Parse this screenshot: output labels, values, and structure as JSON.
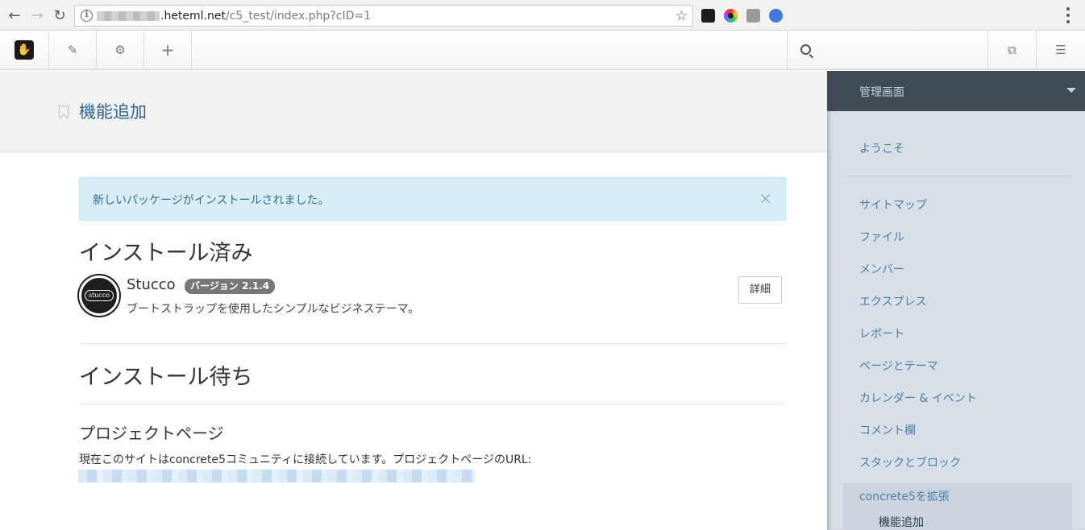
{
  "browser": {
    "url_domain": ".heteml.net",
    "url_path": "/c5_test/index.php?cID=1",
    "back_icon": "←",
    "forward_icon": "→",
    "reload_icon": "↻",
    "star_icon": "☆"
  },
  "toolbar": {
    "logo_icon": "✋",
    "edit_icon": "✎",
    "settings_icon": "⚙",
    "add_icon": "+",
    "pages_icon": "⧉",
    "dashboard_icon": "☰"
  },
  "page": {
    "title": "機能追加"
  },
  "alert": {
    "message": "新しいパッケージがインストールされました。",
    "close": "×"
  },
  "installed": {
    "heading": "インストール済み",
    "package": {
      "icon_text": "stucco",
      "name": "Stucco",
      "version_badge": "バージョン 2.1.4",
      "description": "ブートストラップを使用したシンプルなビジネステーマ。",
      "detail_button": "詳細"
    }
  },
  "pending": {
    "heading": "インストール待ち"
  },
  "project": {
    "heading": "プロジェクトページ",
    "description": "現在このサイトはconcrete5コミュニティに接続しています。プロジェクトページのURL:"
  },
  "sidebar": {
    "title": "管理画面",
    "welcome": "ようこそ",
    "items": [
      "サイトマップ",
      "ファイル",
      "メンバー",
      "エクスプレス",
      "レポート",
      "ページとテーマ",
      "カレンダー & イベント",
      "コメント欄",
      "スタックとブロック"
    ],
    "active_item": "concrete5を拡張",
    "active_sub_item": "機能追加"
  }
}
